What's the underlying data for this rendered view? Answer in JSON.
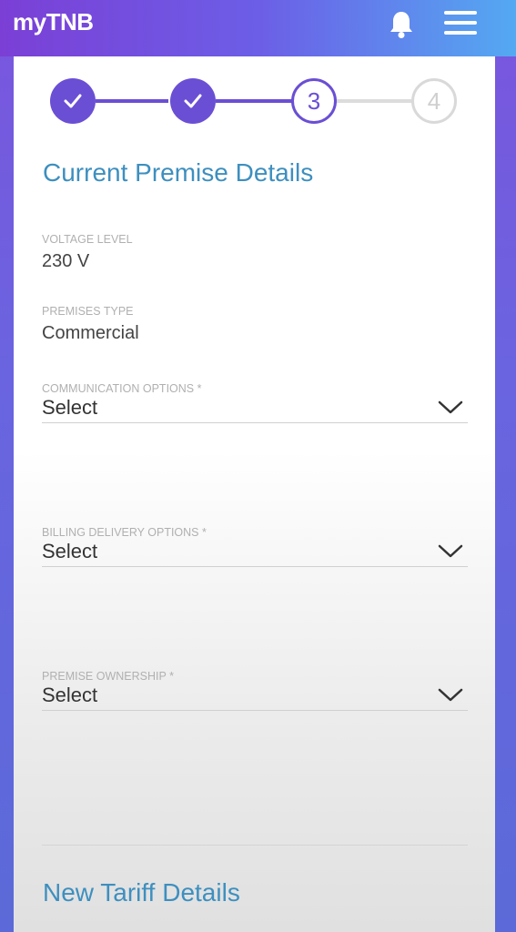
{
  "app": {
    "logo": "myTNB"
  },
  "header": {
    "bell_icon": "bell-icon",
    "menu_icon": "hamburger-menu-icon"
  },
  "stepper": {
    "steps": [
      {
        "label": "",
        "state": "done"
      },
      {
        "label": "",
        "state": "done"
      },
      {
        "label": "3",
        "state": "current"
      },
      {
        "label": "4",
        "state": "pending"
      }
    ]
  },
  "current_premise": {
    "title": "Current Premise Details",
    "voltage_label": "VOLTAGE LEVEL",
    "voltage_value": "230 V",
    "premises_type_label": "PREMISES TYPE",
    "premises_type_value": "Commercial",
    "communication_label": "COMMUNICATION OPTIONS *",
    "communication_value": "Select",
    "billing_label": "BILLING DELIVERY OPTIONS *",
    "billing_value": "Select",
    "ownership_label": "PREMISE OWNERSHIP *",
    "ownership_value": "Select"
  },
  "new_tariff": {
    "title": "New Tariff Details"
  },
  "colors": {
    "accent": "#6a4fd4",
    "title_blue": "#3d8fbf"
  }
}
